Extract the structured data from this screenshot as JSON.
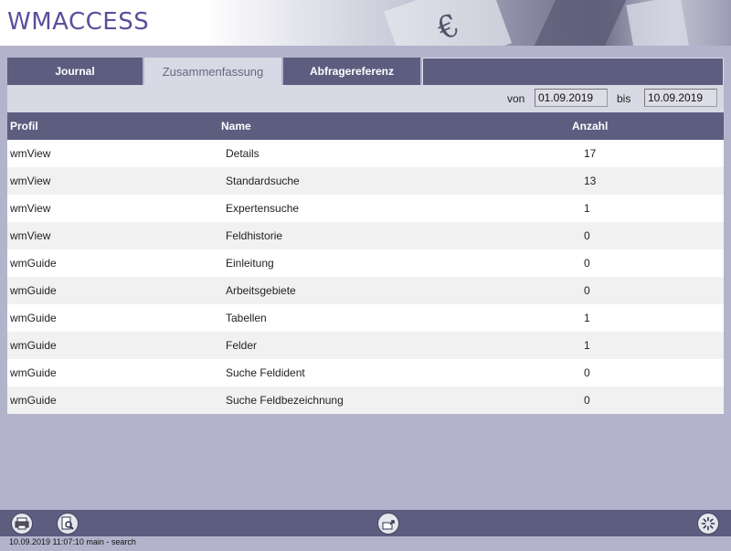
{
  "app": {
    "logo": "WMACCESS"
  },
  "tabs": [
    {
      "label": "Journal",
      "active": false
    },
    {
      "label": "Zusammenfassung",
      "active": true
    },
    {
      "label": "Abfragereferenz",
      "active": false
    }
  ],
  "filter": {
    "from_label": "von",
    "from_value": "01.09.2019",
    "to_label": "bis",
    "to_value": "10.09.2019"
  },
  "table": {
    "headers": {
      "profil": "Profil",
      "name": "Name",
      "anzahl": "Anzahl"
    },
    "rows": [
      {
        "profil": "wmView",
        "name": "Details",
        "anzahl": "17"
      },
      {
        "profil": "wmView",
        "name": "Standardsuche",
        "anzahl": "13"
      },
      {
        "profil": "wmView",
        "name": "Expertensuche",
        "anzahl": "1"
      },
      {
        "profil": "wmView",
        "name": "Feldhistorie",
        "anzahl": "0"
      },
      {
        "profil": "wmGuide",
        "name": "Einleitung",
        "anzahl": "0"
      },
      {
        "profil": "wmGuide",
        "name": "Arbeitsgebiete",
        "anzahl": "0"
      },
      {
        "profil": "wmGuide",
        "name": "Tabellen",
        "anzahl": "1"
      },
      {
        "profil": "wmGuide",
        "name": "Felder",
        "anzahl": "1"
      },
      {
        "profil": "wmGuide",
        "name": "Suche Feldident",
        "anzahl": "0"
      },
      {
        "profil": "wmGuide",
        "name": "Suche Feldbezeichnung",
        "anzahl": "0"
      }
    ]
  },
  "footer": {
    "icons": [
      "print-icon",
      "preview-icon",
      "export-icon",
      "settings-icon"
    ]
  },
  "status": {
    "text": "10.09.2019 11:07:10 main - search"
  },
  "colors": {
    "accent": "#5d5d80",
    "background": "#b3b3cc",
    "logo": "#5b4f9b"
  }
}
